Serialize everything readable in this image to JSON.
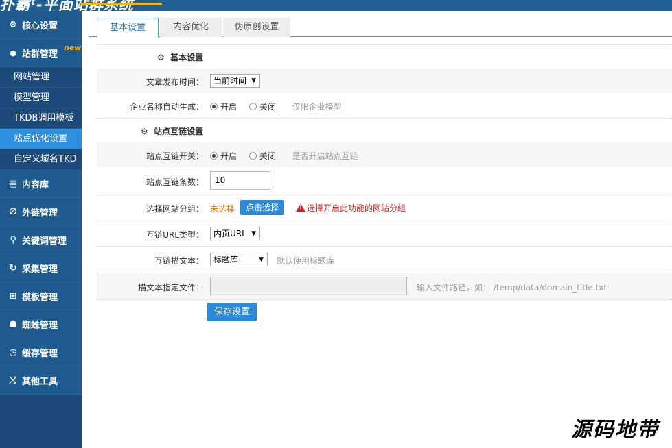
{
  "header": {
    "logo_text": "扑霸ᵗ-平面站群系统"
  },
  "sidebar": {
    "menu": [
      {
        "label": "核心设置",
        "icon": "gear-icon",
        "glyph": "⚙"
      },
      {
        "label": "站群管理",
        "icon": "user-icon",
        "glyph": "👤",
        "badge": "new"
      },
      {
        "label": "内容库",
        "icon": "document-icon",
        "glyph": "▤"
      },
      {
        "label": "外链管理",
        "icon": "link-icon",
        "glyph": "∅"
      },
      {
        "label": "关键词管理",
        "icon": "key-icon",
        "glyph": "⚲"
      },
      {
        "label": "采集管理",
        "icon": "refresh-icon",
        "glyph": "↻"
      },
      {
        "label": "模板管理",
        "icon": "windows-icon",
        "glyph": "⊞"
      },
      {
        "label": "蜘蛛管理",
        "icon": "android-icon",
        "glyph": "☗"
      },
      {
        "label": "缓存管理",
        "icon": "timer-icon",
        "glyph": "◷"
      },
      {
        "label": "其他工具",
        "icon": "shuffle-icon",
        "glyph": "⤮"
      }
    ],
    "submenu": [
      {
        "label": "网站管理"
      },
      {
        "label": "模型管理"
      },
      {
        "label": "TKDB调用模板"
      },
      {
        "label": "站点优化设置",
        "active": true
      },
      {
        "label": "自定义域名TKD"
      }
    ]
  },
  "tabs": [
    {
      "label": "基本设置",
      "active": true
    },
    {
      "label": "内容优化"
    },
    {
      "label": "伪原创设置"
    }
  ],
  "form": {
    "section1_title": "基本设置",
    "publish_time_label": "文章发布时间：",
    "publish_time_value": "当前时间",
    "company_name_label": "企业名称自动生成：",
    "company_name_on": "开启",
    "company_name_off": "关闭",
    "company_name_hint": "仅限企业模型",
    "section2_title": "站点互链设置",
    "interlink_switch_label": "站点互链开关：",
    "interlink_on": "开启",
    "interlink_off": "关闭",
    "interlink_hint": "是否开启站点互链",
    "interlink_count_label": "站点互链条数：",
    "interlink_count_value": "10",
    "site_group_label": "选择网站分组：",
    "site_group_status": "未选择",
    "site_group_button": "点击选择",
    "site_group_warning": "选择开启此功能的网站分组",
    "url_type_label": "互链URL类型：",
    "url_type_value": "内页URL",
    "anchor_text_label": "互链描文本：",
    "anchor_text_value": "标题库",
    "anchor_text_hint": "默认使用标题库",
    "anchor_file_label": "描文本指定文件：",
    "anchor_file_value": "",
    "anchor_file_hint": "输入文件路径，如： /temp/data/domain_title.txt",
    "save_button": "保存设置"
  },
  "watermark": "源码地带",
  "colors": {
    "sidebar_bg": "#1f5a8e",
    "active_sub": "#2d8fde",
    "accent": "#ffb400",
    "button": "#2c8ad6",
    "warning": "#d42020"
  }
}
